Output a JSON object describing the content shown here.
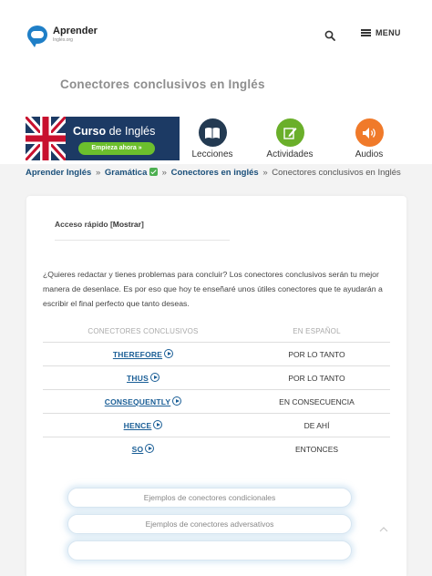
{
  "header": {
    "logo_main": "Aprender",
    "logo_sub": "Inglés.org",
    "menu_label": "MENU",
    "search_icon": "search-icon",
    "menu_icon": "hamburger-icon"
  },
  "page": {
    "title": "Conectores conclusivos en Inglés"
  },
  "banner": {
    "title_bold": "Curso",
    "title_rest": " de Inglés",
    "button_label": "Empieza ahora »"
  },
  "nav": {
    "items": [
      {
        "label": "Lecciones",
        "icon": "book-icon",
        "color": "#233a52"
      },
      {
        "label": "Actividades",
        "icon": "pencil-icon",
        "color": "#6aaf2a"
      },
      {
        "label": "Audios",
        "icon": "speaker-icon",
        "color": "#f07a2a"
      }
    ]
  },
  "breadcrumb": {
    "items": [
      "Aprender Inglés",
      "Gramática",
      "Conectores en inglés",
      "Conectores conclusivos en Inglés"
    ],
    "separator": "»"
  },
  "toc": {
    "label": "Acceso rápido",
    "toggle": "Mostrar"
  },
  "intro": "¿Quieres redactar y tienes problemas para concluir? Los conectores conclusivos serán tu mejor manera de desenlace. Es por eso que hoy te enseñaré unos útiles conectores que te ayudarán a escribir el final perfecto que tanto deseas.",
  "table": {
    "headers": [
      "CONECTORES CONCLUSIVOS",
      "EN ESPAÑOL"
    ],
    "rows": [
      {
        "en": "THEREFORE",
        "es": "POR LO TANTO"
      },
      {
        "en": "THUS",
        "es": "POR LO TANTO"
      },
      {
        "en": "CONSEQUENTLY",
        "es": "EN CONSECUENCIA"
      },
      {
        "en": "HENCE",
        "es": "DE AHÍ"
      },
      {
        "en": "SO",
        "es": "ENTONCES"
      }
    ]
  },
  "related": [
    "Ejemplos de conectores condicionales",
    "Ejemplos de conectores adversativos",
    ""
  ],
  "colors": {
    "accent": "#1a5e96",
    "banner_bg": "#1c3a64",
    "banner_button": "#6cbf2d"
  }
}
